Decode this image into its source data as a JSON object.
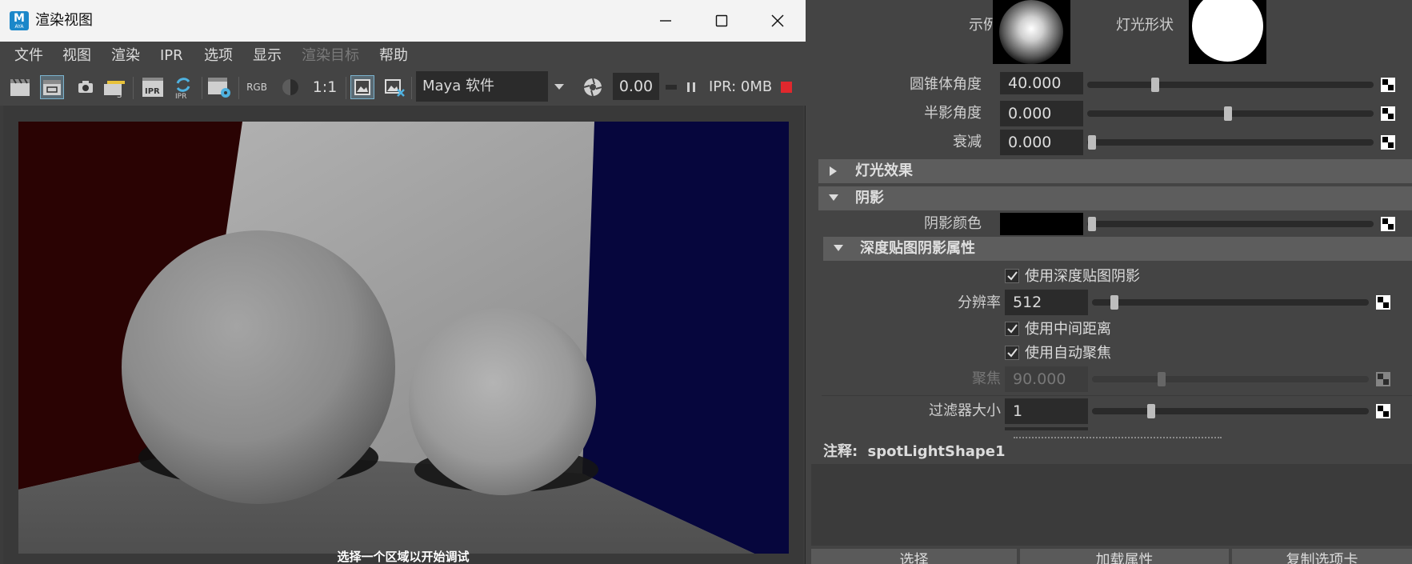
{
  "window": {
    "title": "渲染视图",
    "logo_letter": "M",
    "logo_sub": "AYA"
  },
  "menu": [
    "文件",
    "视图",
    "渲染",
    "IPR",
    "选项",
    "显示",
    "渲染目标",
    "帮助"
  ],
  "menu_disabled": [
    false,
    false,
    false,
    false,
    false,
    false,
    true,
    false
  ],
  "toolbar": {
    "rgb_label": "RGB",
    "ratio_label": "1:1",
    "renderer": "Maya 软件",
    "time_value": "0.00",
    "ipr_memory": "IPR: 0MB",
    "ipr_label": "IPR"
  },
  "viewport": {
    "status": "选择一个区域以开始调试"
  },
  "attr_editor": {
    "sample_label": "示例",
    "light_shape_label": "灯光形状",
    "cone_angle": {
      "label": "圆锥体角度",
      "value": "40.000",
      "slider": 0.23
    },
    "penumbra_angle": {
      "label": "半影角度",
      "value": "0.000",
      "slider": 0.5
    },
    "dropoff": {
      "label": "衰减",
      "value": "0.000",
      "slider": 0.0
    },
    "light_effects_header": "灯光效果",
    "shadows_header": "阴影",
    "shadow_color": {
      "label": "阴影颜色",
      "value_color": "#000000",
      "slider": 0.0
    },
    "depth_map_header": "深度贴图阴影属性",
    "use_depth_map": {
      "label": "使用深度贴图阴影",
      "checked": true
    },
    "resolution": {
      "label": "分辨率",
      "value": "512",
      "slider": 0.07
    },
    "use_mid_dist": {
      "label": "使用中间距离",
      "checked": true
    },
    "use_auto_focus": {
      "label": "使用自动聚焦",
      "checked": true
    },
    "focus": {
      "label": "聚焦",
      "value": "90.000",
      "slider": 0.25
    },
    "filter_size": {
      "label": "过滤器大小",
      "value": "1",
      "slider": 0.2
    },
    "notes_label": "注释:",
    "notes_node": "spotLightShape1",
    "buttons": [
      "选择",
      "加载属性",
      "复制选项卡"
    ]
  },
  "colors": {
    "accent": "#1b87c9",
    "stop_red": "#e0282d",
    "left_wall": "#2a0303",
    "right_wall": "#06063d"
  }
}
